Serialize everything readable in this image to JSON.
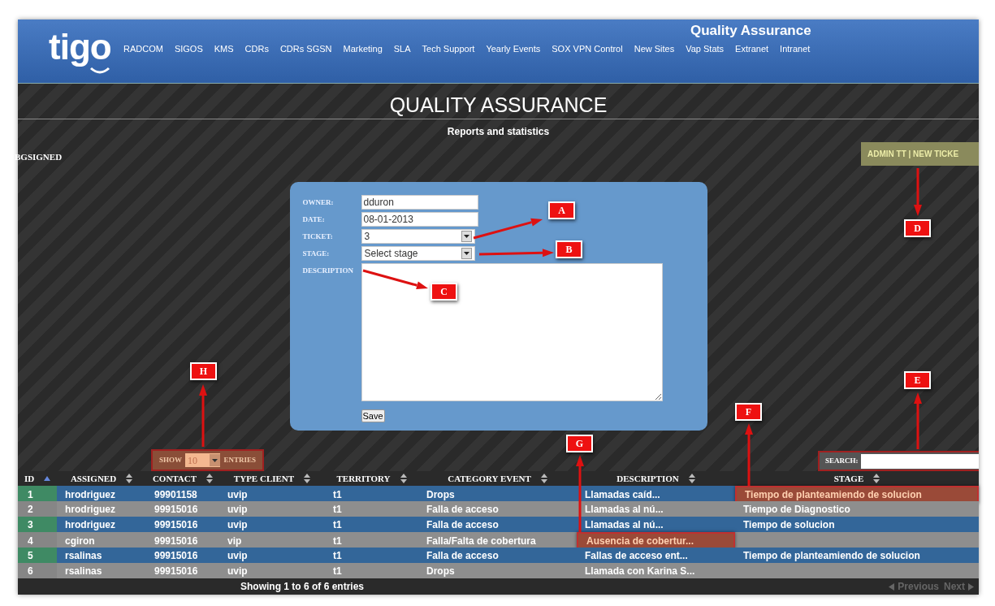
{
  "header": {
    "logo": "tigo",
    "title": "Quality Assurance",
    "nav": [
      {
        "label": "RADCOM"
      },
      {
        "label": "SIGOS"
      },
      {
        "label": "KMS"
      },
      {
        "label": "CDRs"
      },
      {
        "label": "CDRs SGSN"
      },
      {
        "label": "Marketing"
      },
      {
        "label": "SLA"
      },
      {
        "label": "Tech Support"
      },
      {
        "label": "Yearly Events"
      },
      {
        "label": "SOX VPN Control"
      },
      {
        "label": "New Sites"
      },
      {
        "label": "Vap Stats"
      },
      {
        "label": "Extranet"
      },
      {
        "label": "Intranet"
      }
    ]
  },
  "page": {
    "title": "QUALITY ASSURANCE",
    "subtitle": "Reports and statistics",
    "user": "BGSIGNED",
    "admin_links": "ADMIN TT | NEW TICKE"
  },
  "form": {
    "fields": [
      {
        "label": "OWNER:",
        "kind": "text",
        "value": "dduron"
      },
      {
        "label": "DATE:",
        "kind": "text",
        "value": "08-01-2013"
      },
      {
        "label": "TICKET:",
        "kind": "select",
        "value": "3"
      },
      {
        "label": "STAGE:",
        "kind": "select",
        "value": "Select stage"
      },
      {
        "label": "DESCRIPTION",
        "kind": "textarea"
      }
    ],
    "button": "Save"
  },
  "table": {
    "length_menu": {
      "show": "SHOW",
      "value": "10",
      "entries": "ENTRIES"
    },
    "search": {
      "label": "SEARCH:"
    },
    "columns": [
      {
        "label": "ID",
        "sorted": true
      },
      {
        "label": "ASSIGNED",
        "sorted": false
      },
      {
        "label": "CONTACT",
        "sorted": false
      },
      {
        "label": "TYPE CLIENT",
        "sorted": false
      },
      {
        "label": "TERRITORY",
        "sorted": false
      },
      {
        "label": "CATEGORY EVENT",
        "sorted": false
      },
      {
        "label": "DESCRIPTION",
        "sorted": false
      },
      {
        "label": "STAGE",
        "sorted": false
      }
    ],
    "rows": [
      {
        "cells": [
          "1",
          "hrodriguez",
          "99901158",
          "uvip",
          "t1",
          "Drops",
          "Llamadas caíd...",
          "Tiempo de planteamiendo de solucion"
        ],
        "stage_highlighted": true
      },
      {
        "cells": [
          "2",
          "hrodriguez",
          "99915016",
          "uvip",
          "t1",
          "Falla de acceso",
          "Llamadas al nú...",
          "Tiempo de Diagnostico"
        ]
      },
      {
        "cells": [
          "3",
          "hrodriguez",
          "99915016",
          "uvip",
          "t1",
          "Falla de acceso",
          "Llamadas al nú...",
          "Tiempo de solucion"
        ]
      },
      {
        "cells": [
          "4",
          "cgiron",
          "99915016",
          "vip",
          "t1",
          "Falla/Falta de cobertura",
          "Ausencia de cobertur...",
          ""
        ],
        "description_highlighted": true
      },
      {
        "cells": [
          "5",
          "rsalinas",
          "99915016",
          "uvip",
          "t1",
          "Falla de acceso",
          "Fallas de acceso ent...",
          "Tiempo de planteamiendo de solucion"
        ]
      },
      {
        "cells": [
          "6",
          "rsalinas",
          "99915016",
          "uvip",
          "t1",
          "Drops",
          "Llamada con Karina S...",
          ""
        ]
      }
    ],
    "info": "Showing 1 to 6 of 6 entries",
    "pagination": {
      "previous": "Previous",
      "next": "Next"
    }
  },
  "annotations": [
    {
      "label": "A"
    },
    {
      "label": "B"
    },
    {
      "label": "C"
    },
    {
      "label": "D"
    },
    {
      "label": "E"
    },
    {
      "label": "F"
    },
    {
      "label": "G"
    },
    {
      "label": "H"
    }
  ]
}
